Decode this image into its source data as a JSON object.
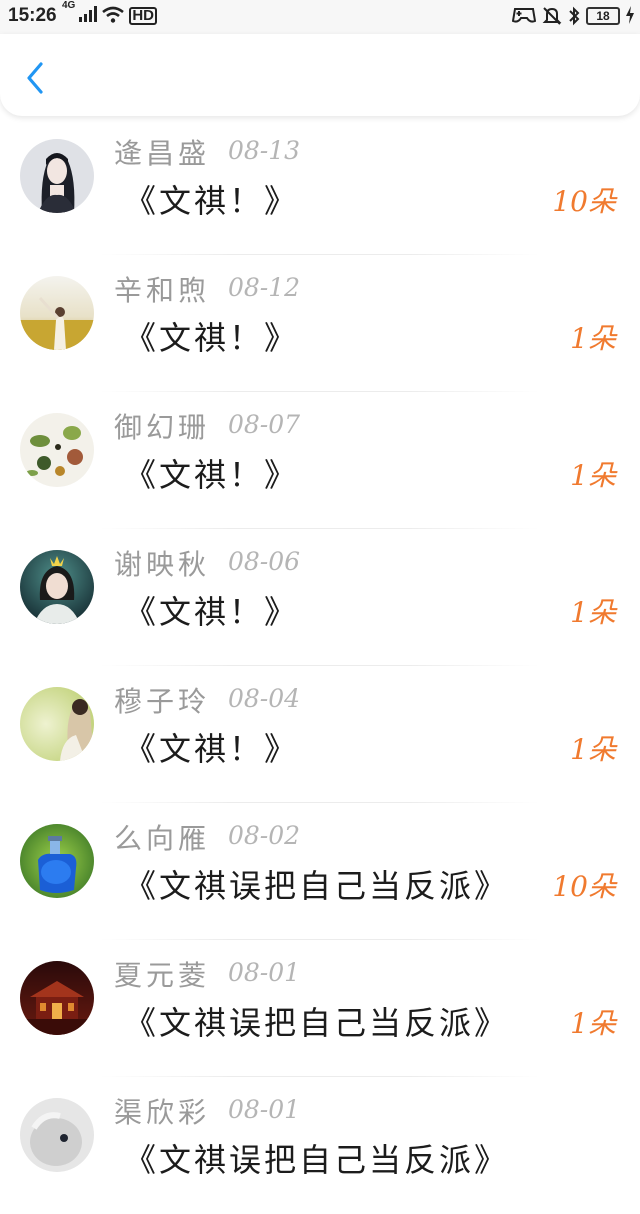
{
  "status_bar": {
    "time": "15:26",
    "network_label": "4G",
    "hd_label": "HD",
    "battery": "18"
  },
  "header": {
    "back_icon": "chevron-left-icon",
    "accent_color": "#2196f3"
  },
  "list": [
    {
      "name": "逄昌盛",
      "date": "08-13",
      "title": "《文祺！》",
      "gift": "10朵",
      "avatar": "girl-portrait"
    },
    {
      "name": "辛和煦",
      "date": "08-12",
      "title": "《文祺！》",
      "gift": "1朵",
      "avatar": "field-sunset"
    },
    {
      "name": "御幻珊",
      "date": "08-07",
      "title": "《文祺！》",
      "gift": "1朵",
      "avatar": "herbs-flatlay"
    },
    {
      "name": "谢映秋",
      "date": "08-06",
      "title": "《文祺！》",
      "gift": "1朵",
      "avatar": "girl-dark-bg"
    },
    {
      "name": "穆子玲",
      "date": "08-04",
      "title": "《文祺！》",
      "gift": "1朵",
      "avatar": "pale-green-portrait"
    },
    {
      "name": "么向雁",
      "date": "08-02",
      "title": "《文祺误把自己当反派》",
      "gift": "10朵",
      "avatar": "blue-bottle"
    },
    {
      "name": "夏元菱",
      "date": "08-01",
      "title": "《文祺误把自己当反派》",
      "gift": "1朵",
      "avatar": "night-palace"
    },
    {
      "name": "渠欣彩",
      "date": "08-01",
      "title": "《文祺误把自己当反派》",
      "gift": "",
      "avatar": "grey-animal"
    }
  ],
  "colors": {
    "name": "#9a9a9a",
    "date": "#b5b5b5",
    "title": "#1c1c1c",
    "gift": "#f07a2f"
  }
}
